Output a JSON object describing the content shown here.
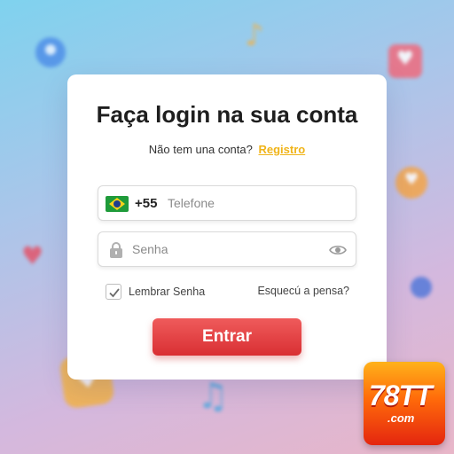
{
  "login": {
    "title": "Faça login na sua conta",
    "signup_prompt": "Não tem una conta?",
    "signup_link": "Registro",
    "phone": {
      "country_flag": "brazil-flag-icon",
      "dial_code": "+55",
      "placeholder": "Telefone",
      "value": ""
    },
    "password": {
      "placeholder": "Senha",
      "value": "",
      "leading_icon": "lock-icon",
      "toggle_icon": "eye-icon"
    },
    "remember_me": {
      "label": "Lembrar Senha",
      "checked": true
    },
    "forgot_link": "Esquecú a pensa?",
    "submit_label": "Entrar"
  },
  "branding": {
    "logo_text_main": "78TT",
    "logo_text_sub": ".com"
  },
  "colors": {
    "accent_link": "#f0b419",
    "button": "#d92f33",
    "card": "#ffffff"
  }
}
